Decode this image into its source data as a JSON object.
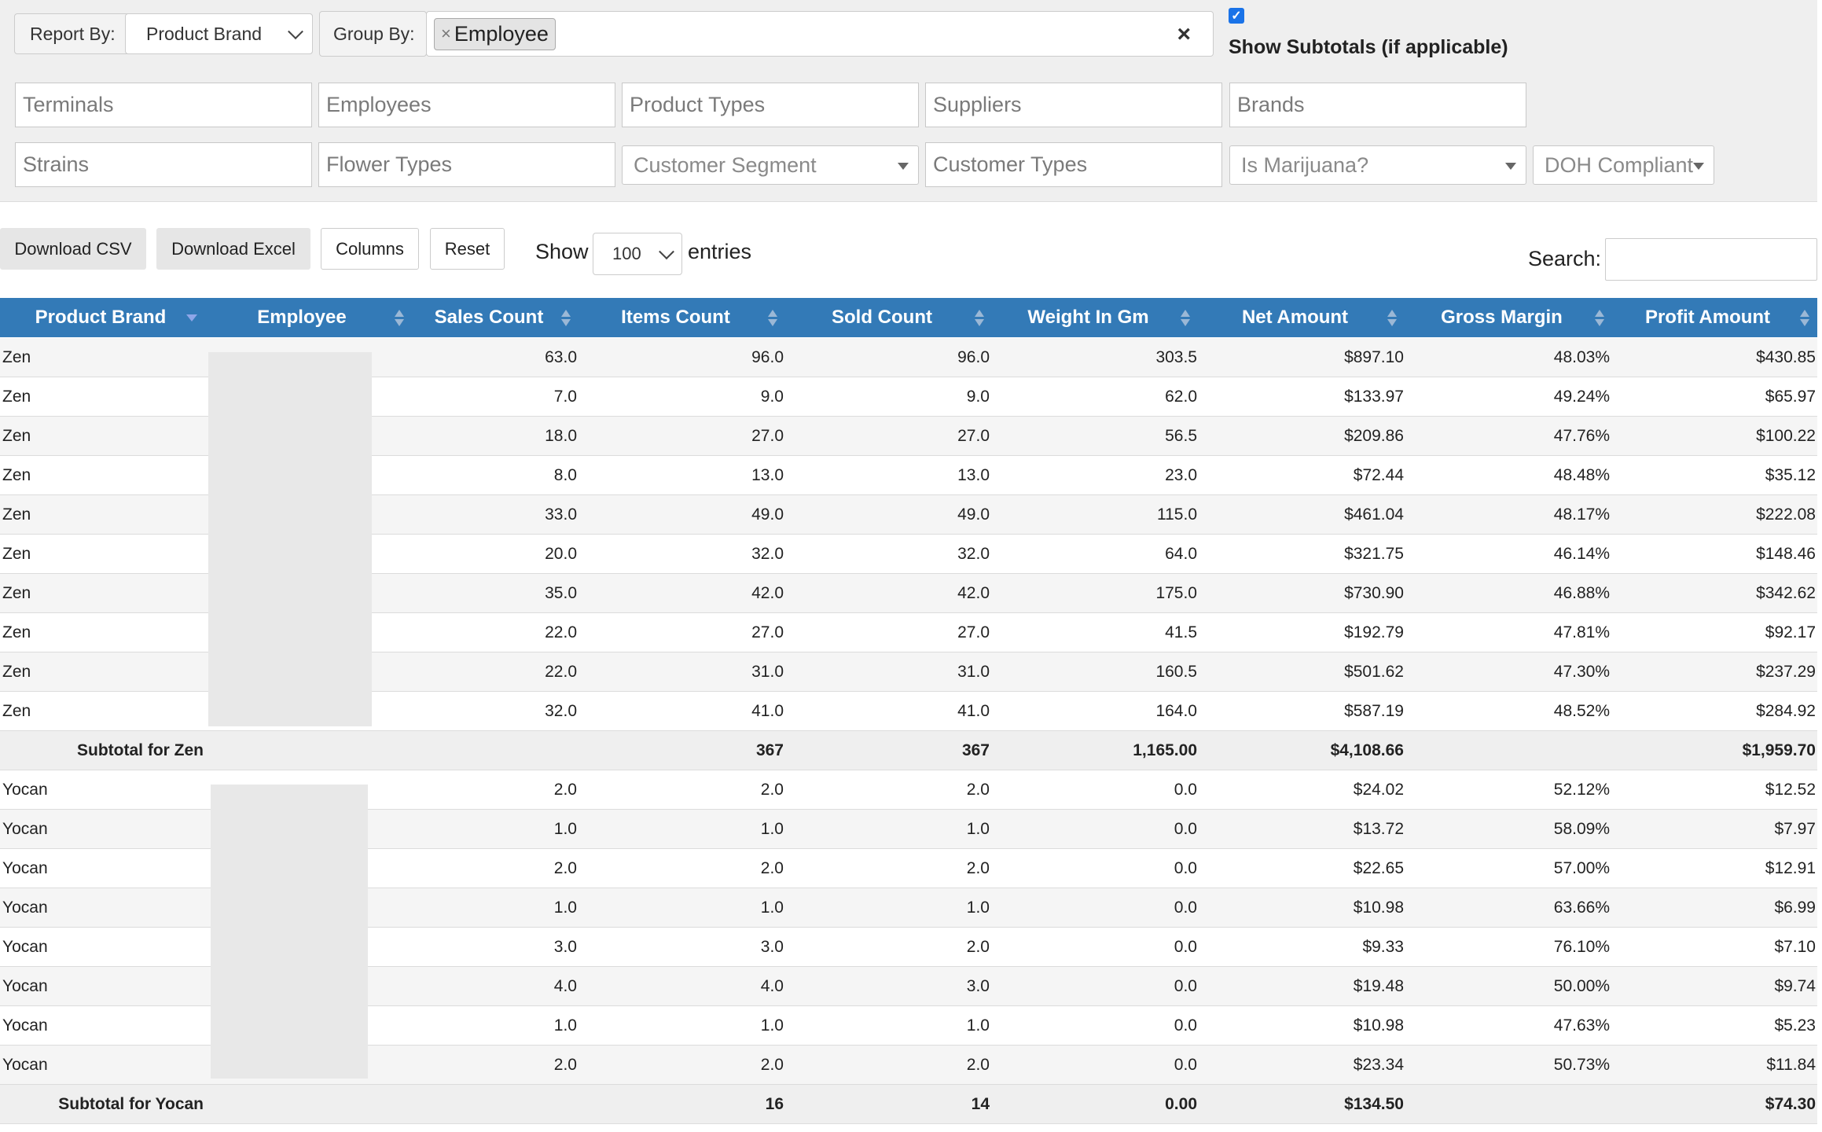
{
  "filters": {
    "report_by_label": "Report By:",
    "report_by_value": "Product Brand",
    "group_by_label": "Group By:",
    "group_by_tag": "Employee",
    "show_subtotals_label": "Show Subtotals (if applicable)",
    "show_subtotals_checked": true,
    "terminals": "Terminals",
    "employees": "Employees",
    "product_types": "Product Types",
    "suppliers": "Suppliers",
    "brands": "Brands",
    "strains": "Strains",
    "flower_types": "Flower Types",
    "customer_segment": "Customer Segment",
    "customer_types": "Customer Types",
    "is_marijuana": "Is Marijuana?",
    "doh_compliant": "DOH Compliant"
  },
  "toolbar": {
    "download_csv": "Download CSV",
    "download_excel": "Download Excel",
    "columns": "Columns",
    "reset": "Reset",
    "show_label": "Show",
    "entries_value": "100",
    "entries_label": "entries",
    "search_label": "Search:"
  },
  "table": {
    "columns": [
      "Product Brand",
      "Employee",
      "Sales Count",
      "Items Count",
      "Sold Count",
      "Weight In Gm",
      "Net Amount",
      "Gross Margin",
      "Profit Amount"
    ],
    "rows": [
      {
        "type": "data",
        "brand": "Zen",
        "cells": [
          "63.0",
          "96.0",
          "96.0",
          "303.5",
          "$897.10",
          "48.03%",
          "$430.85"
        ]
      },
      {
        "type": "data",
        "brand": "Zen",
        "cells": [
          "7.0",
          "9.0",
          "9.0",
          "62.0",
          "$133.97",
          "49.24%",
          "$65.97"
        ]
      },
      {
        "type": "data",
        "brand": "Zen",
        "cells": [
          "18.0",
          "27.0",
          "27.0",
          "56.5",
          "$209.86",
          "47.76%",
          "$100.22"
        ]
      },
      {
        "type": "data",
        "brand": "Zen",
        "cells": [
          "8.0",
          "13.0",
          "13.0",
          "23.0",
          "$72.44",
          "48.48%",
          "$35.12"
        ]
      },
      {
        "type": "data",
        "brand": "Zen",
        "cells": [
          "33.0",
          "49.0",
          "49.0",
          "115.0",
          "$461.04",
          "48.17%",
          "$222.08"
        ]
      },
      {
        "type": "data",
        "brand": "Zen",
        "cells": [
          "20.0",
          "32.0",
          "32.0",
          "64.0",
          "$321.75",
          "46.14%",
          "$148.46"
        ]
      },
      {
        "type": "data",
        "brand": "Zen",
        "cells": [
          "35.0",
          "42.0",
          "42.0",
          "175.0",
          "$730.90",
          "46.88%",
          "$342.62"
        ]
      },
      {
        "type": "data",
        "brand": "Zen",
        "cells": [
          "22.0",
          "27.0",
          "27.0",
          "41.5",
          "$192.79",
          "47.81%",
          "$92.17"
        ]
      },
      {
        "type": "data",
        "brand": "Zen",
        "cells": [
          "22.0",
          "31.0",
          "31.0",
          "160.5",
          "$501.62",
          "47.30%",
          "$237.29"
        ]
      },
      {
        "type": "data",
        "brand": "Zen",
        "cells": [
          "32.0",
          "41.0",
          "41.0",
          "164.0",
          "$587.19",
          "48.52%",
          "$284.92"
        ]
      },
      {
        "type": "sub",
        "label": "Subtotal for Zen",
        "cells": [
          "",
          "367",
          "367",
          "1,165.00",
          "$4,108.66",
          "",
          "$1,959.70"
        ]
      },
      {
        "type": "data",
        "brand": "Yocan",
        "cells": [
          "2.0",
          "2.0",
          "2.0",
          "0.0",
          "$24.02",
          "52.12%",
          "$12.52"
        ]
      },
      {
        "type": "data",
        "brand": "Yocan",
        "cells": [
          "1.0",
          "1.0",
          "1.0",
          "0.0",
          "$13.72",
          "58.09%",
          "$7.97"
        ]
      },
      {
        "type": "data",
        "brand": "Yocan",
        "cells": [
          "2.0",
          "2.0",
          "2.0",
          "0.0",
          "$22.65",
          "57.00%",
          "$12.91"
        ]
      },
      {
        "type": "data",
        "brand": "Yocan",
        "cells": [
          "1.0",
          "1.0",
          "1.0",
          "0.0",
          "$10.98",
          "63.66%",
          "$6.99"
        ]
      },
      {
        "type": "data",
        "brand": "Yocan",
        "cells": [
          "3.0",
          "3.0",
          "2.0",
          "0.0",
          "$9.33",
          "76.10%",
          "$7.10"
        ]
      },
      {
        "type": "data",
        "brand": "Yocan",
        "cells": [
          "4.0",
          "4.0",
          "3.0",
          "0.0",
          "$19.48",
          "50.00%",
          "$9.74"
        ]
      },
      {
        "type": "data",
        "brand": "Yocan",
        "cells": [
          "1.0",
          "1.0",
          "1.0",
          "0.0",
          "$10.98",
          "47.63%",
          "$5.23"
        ]
      },
      {
        "type": "data",
        "brand": "Yocan",
        "cells": [
          "2.0",
          "2.0",
          "2.0",
          "0.0",
          "$23.34",
          "50.73%",
          "$11.84"
        ]
      },
      {
        "type": "sub",
        "label": "Subtotal for Yocan",
        "cells": [
          "",
          "16",
          "14",
          "0.00",
          "$134.50",
          "",
          "$74.30"
        ]
      }
    ]
  }
}
